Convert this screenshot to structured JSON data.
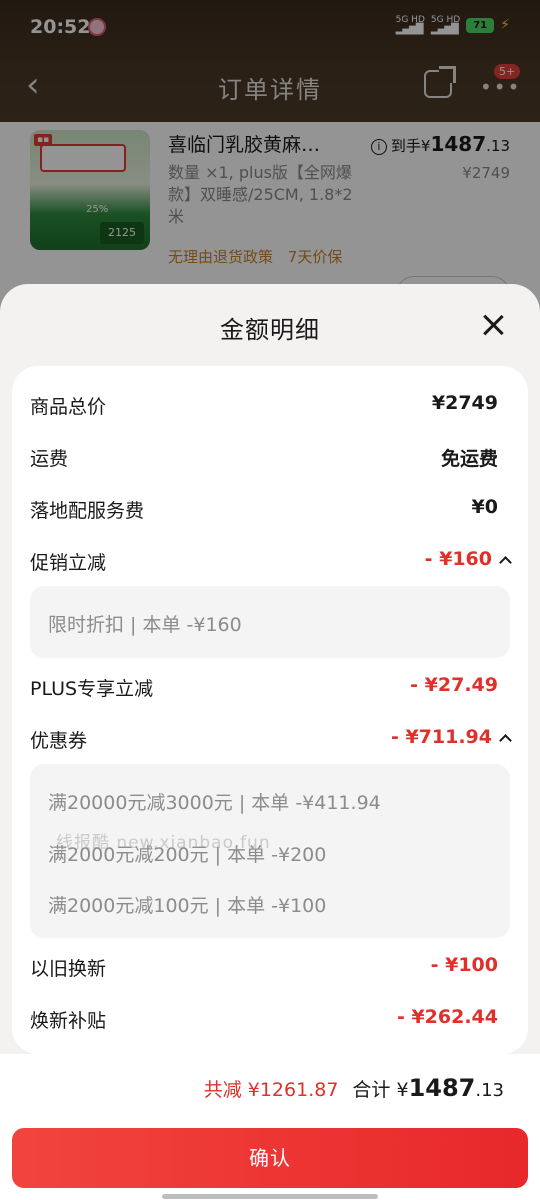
{
  "status_bar": {
    "time": "20:52",
    "net1": "5G HD",
    "net2": "5G HD",
    "battery": "71"
  },
  "nav": {
    "title": "订单详情",
    "more_badge": "5+"
  },
  "product": {
    "title": "喜临门乳胶黄麻…",
    "spec": "数量 ×1, plus版【全网爆款】双睡感/25CM, 1.8*2米",
    "policy_return": "无理由退货政策",
    "policy_price": "7天价保",
    "price_prefix": "到手¥",
    "price_int": "1487",
    "price_dec": ".13",
    "original_price": "¥2749",
    "thumb_price": "2125",
    "thumb_pct": "25%"
  },
  "sheet": {
    "title": "金额明细",
    "rows": {
      "total_price": {
        "label": "商品总价",
        "value": "¥2749"
      },
      "shipping": {
        "label": "运费",
        "value": "免运费"
      },
      "delivery_service": {
        "label": "落地配服务费",
        "value": "¥0"
      },
      "promo": {
        "label": "促销立减",
        "value": "- ¥160"
      },
      "plus": {
        "label": "PLUS专享立减",
        "value": "- ¥27.49"
      },
      "coupon": {
        "label": "优惠券",
        "value": "- ¥711.94"
      },
      "trade_in": {
        "label": "以旧换新",
        "value": "- ¥100"
      },
      "subsidy": {
        "label": "焕新补贴",
        "value": "- ¥262.44"
      }
    },
    "promo_details": [
      "限时折扣 | 本单 -¥160"
    ],
    "coupon_details": [
      "满20000元减3000元 | 本单 -¥411.94",
      "满2000元减200元 | 本单 -¥200",
      "满2000元减100元 | 本单 -¥100"
    ],
    "watermark": "线报酷 new.xianbao.fun"
  },
  "footer": {
    "total_reduce": "共减 ¥1261.87",
    "total_label": "合计 ¥",
    "total_int": "1487",
    "total_dec": ".13",
    "confirm_label": "确认"
  },
  "colors": {
    "accent_red": "#e0302a",
    "confirm_button": "#ef3a36",
    "header_brown": "#4a3826",
    "policy_orange": "#c9822e"
  }
}
